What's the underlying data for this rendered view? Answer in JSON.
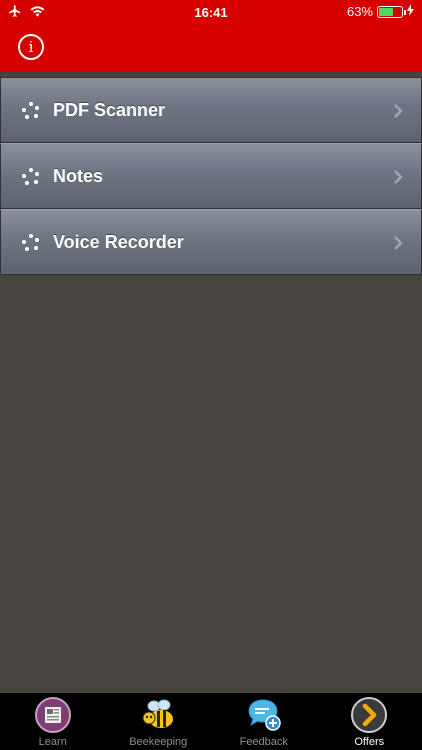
{
  "status": {
    "time": "16:41",
    "battery": "63%",
    "battery_level": 0.63
  },
  "header": {
    "info_icon": "i"
  },
  "menu": {
    "items": [
      {
        "label": "PDF Scanner"
      },
      {
        "label": "Notes"
      },
      {
        "label": "Voice Recorder"
      }
    ]
  },
  "tabbar": {
    "tabs": [
      {
        "label": "Learn",
        "icon": "newspaper-icon"
      },
      {
        "label": "Beekeeping",
        "icon": "bee-icon"
      },
      {
        "label": "Feedback",
        "icon": "chat-bubble-plus-icon"
      },
      {
        "label": "Offers",
        "icon": "chevron-circle-icon"
      }
    ],
    "active": "Offers"
  },
  "colors": {
    "header": "#d60000",
    "background": "#474440",
    "battery": "#4cd964"
  }
}
